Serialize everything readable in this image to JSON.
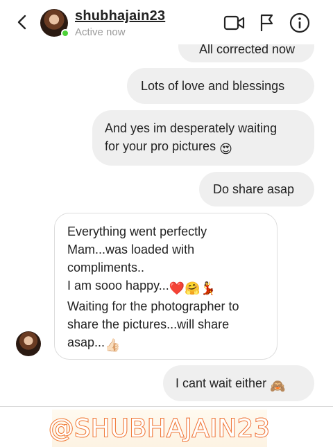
{
  "header": {
    "username": "shubhajain23",
    "status": "Active now",
    "icons": [
      "back-chevron-icon",
      "video-call-icon",
      "flag-icon",
      "info-icon"
    ]
  },
  "messages": [
    {
      "direction": "sent",
      "text": "All corrected now",
      "partial": true
    },
    {
      "direction": "sent",
      "text": "Lots of love and blessings"
    },
    {
      "direction": "sent",
      "lines": [
        "And yes im desperately waiting",
        "for your pro pictures"
      ],
      "emoji": "😍"
    },
    {
      "direction": "sent",
      "text": "Do share asap"
    },
    {
      "direction": "received",
      "lines": [
        "Everything went perfectly",
        "Mam...was loaded with",
        "compliments..",
        "I am sooo happy...",
        "Waiting for the photographer to",
        "share the pictures...will share",
        "asap..."
      ],
      "emoji_line4": "❤️🤗💃",
      "emoji_line7": "👍🏻"
    },
    {
      "direction": "sent",
      "text": "I cant wait either",
      "emoji": "🙈"
    }
  ],
  "footer": {
    "handle": "@SHUBHAJAIN23"
  },
  "colors": {
    "sent_bubble": "#efefef",
    "received_border": "#dcdcdc",
    "online": "#4cd137",
    "handle_gradient": [
      "#f59a2a",
      "#ef5a3c",
      "#e24a76"
    ]
  }
}
